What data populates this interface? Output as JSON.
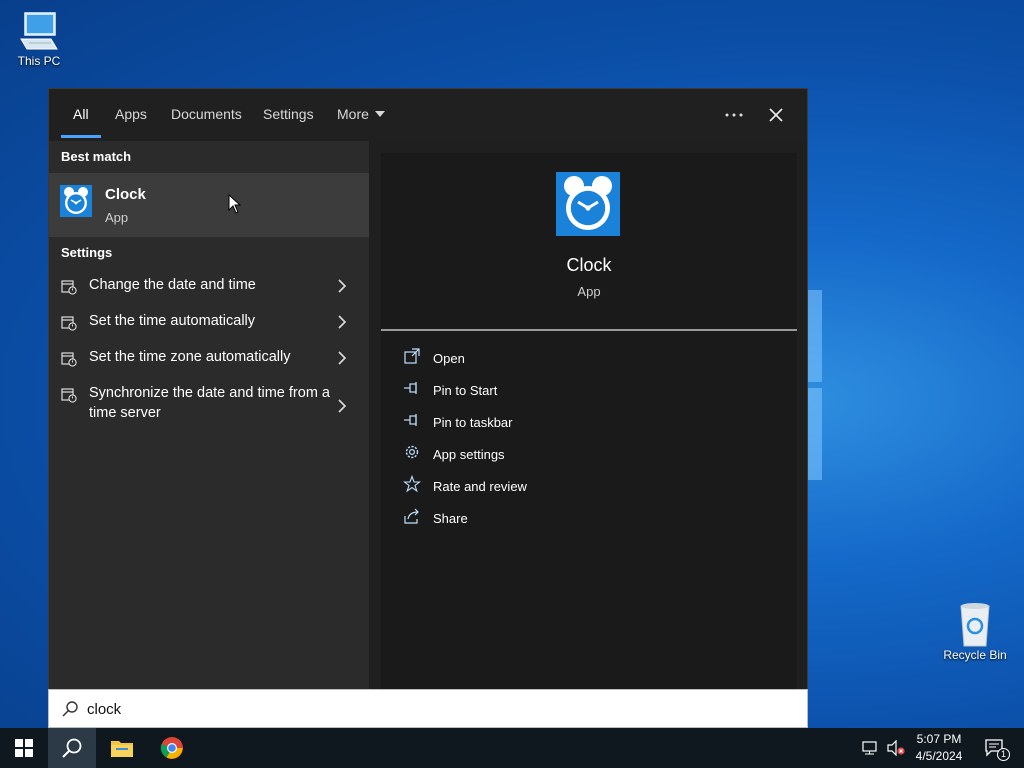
{
  "desktop": {
    "this_pc_label": "This PC",
    "recycle_bin_label": "Recycle Bin"
  },
  "search": {
    "tabs": [
      {
        "label": "All",
        "active": true
      },
      {
        "label": "Apps"
      },
      {
        "label": "Documents"
      },
      {
        "label": "Settings"
      },
      {
        "label": "More"
      }
    ],
    "best_match_label": "Best match",
    "best_match": {
      "title": "Clock",
      "type": "App"
    },
    "settings_label": "Settings",
    "settings_items": [
      {
        "label": "Change the date and time"
      },
      {
        "label": "Set the time automatically"
      },
      {
        "label": "Set the time zone automatically"
      },
      {
        "label": "Synchronize the date and time from a time server"
      }
    ],
    "preview": {
      "title": "Clock",
      "type": "App",
      "actions": [
        {
          "label": "Open",
          "icon": "open-icon"
        },
        {
          "label": "Pin to Start",
          "icon": "pin-icon"
        },
        {
          "label": "Pin to taskbar",
          "icon": "pin-icon"
        },
        {
          "label": "App settings",
          "icon": "gear-icon"
        },
        {
          "label": "Rate and review",
          "icon": "star-icon"
        },
        {
          "label": "Share",
          "icon": "share-icon"
        }
      ]
    },
    "query": "clock"
  },
  "taskbar": {
    "time": "5:07 PM",
    "date": "4/5/2024",
    "notification_count": "1"
  },
  "colors": {
    "accent": "#4aa3ff",
    "clock_icon_bg": "#1a82d8"
  }
}
